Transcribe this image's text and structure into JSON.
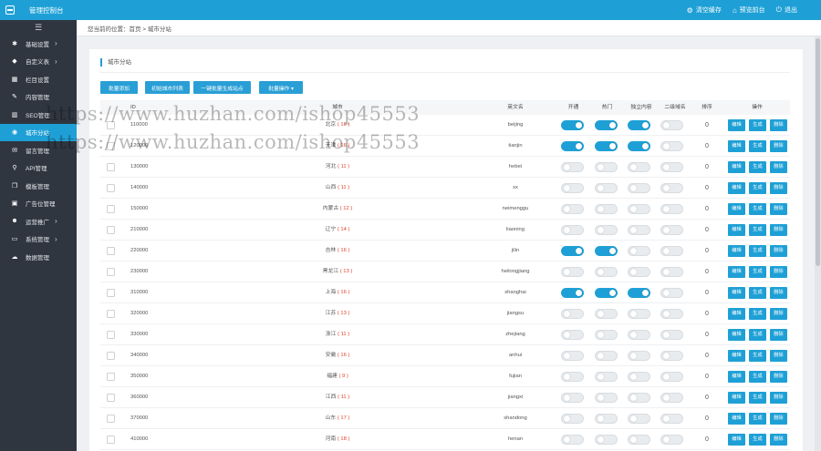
{
  "app": {
    "title": "管理控制台"
  },
  "topbar": {
    "actions": [
      {
        "icon": "gear-icon",
        "glyph": "⚙",
        "label": "清空缓存"
      },
      {
        "icon": "home-icon",
        "glyph": "⌂",
        "label": "预览前台"
      },
      {
        "icon": "power-icon",
        "glyph": "⏻",
        "label": "退出"
      }
    ]
  },
  "sidebar": {
    "toggle_glyph": "☰",
    "items": [
      {
        "icon": "gear-icon",
        "glyph": "✱",
        "label": "基础设置",
        "arrow": "›"
      },
      {
        "icon": "tag-icon",
        "glyph": "◆",
        "label": "自定义表",
        "arrow": "›"
      },
      {
        "icon": "grid-icon",
        "glyph": "▦",
        "label": "栏目设置",
        "arrow": ""
      },
      {
        "icon": "edit-icon",
        "glyph": "✎",
        "label": "内容管理",
        "arrow": ""
      },
      {
        "icon": "chart-icon",
        "glyph": "▥",
        "label": "SEO管理",
        "arrow": ""
      },
      {
        "icon": "globe-icon",
        "glyph": "◉",
        "label": "城市分站",
        "arrow": ""
      },
      {
        "icon": "chat-icon",
        "glyph": "✉",
        "label": "留言管理",
        "arrow": ""
      },
      {
        "icon": "link-icon",
        "glyph": "⚲",
        "label": "API管理",
        "arrow": ""
      },
      {
        "icon": "copy-icon",
        "glyph": "❐",
        "label": "模板管理",
        "arrow": ""
      },
      {
        "icon": "image-icon",
        "glyph": "▣",
        "label": "广告位管理",
        "arrow": ""
      },
      {
        "icon": "users-icon",
        "glyph": "☻",
        "label": "运营推广",
        "arrow": "›"
      },
      {
        "icon": "monitor-icon",
        "glyph": "▭",
        "label": "系统管理",
        "arrow": "›"
      },
      {
        "icon": "cloud-icon",
        "glyph": "☁",
        "label": "数据管理",
        "arrow": ""
      }
    ]
  },
  "breadcrumb": "您当前的位置：首页 > 城市分站",
  "panel": {
    "title": "城市分站"
  },
  "toolbar": {
    "buttons": [
      "批量添加",
      "初始城市列表",
      "一键批量生成站点",
      "批量操作 ▾"
    ]
  },
  "table": {
    "headers": {
      "id": "ID",
      "name": "城市",
      "pinyin": "英文名",
      "open": "开通",
      "hot": "热门",
      "independent": "独立内容",
      "second_domain": "二级域名",
      "order": "排序",
      "ops": "操作"
    },
    "op_labels": [
      "编辑",
      "生成",
      "删除"
    ],
    "rows": [
      {
        "code": "110000",
        "name": "北京",
        "count": "( 16 )",
        "pinyin": "beijing",
        "open": true,
        "hot": true,
        "independent": true,
        "second": false,
        "order": "0"
      },
      {
        "code": "120000",
        "name": "天津",
        "count": "( 16 )",
        "pinyin": "tianjin",
        "open": true,
        "hot": true,
        "independent": true,
        "second": false,
        "order": "0"
      },
      {
        "code": "130000",
        "name": "河北",
        "count": "( 11 )",
        "pinyin": "hebei",
        "open": false,
        "hot": false,
        "independent": false,
        "second": false,
        "order": "0"
      },
      {
        "code": "140000",
        "name": "山西",
        "count": "( 11 )",
        "pinyin": "sx",
        "open": false,
        "hot": false,
        "independent": false,
        "second": false,
        "order": "0"
      },
      {
        "code": "150000",
        "name": "内蒙古",
        "count": "( 12 )",
        "pinyin": "neimenggu",
        "open": false,
        "hot": false,
        "independent": false,
        "second": false,
        "order": "0"
      },
      {
        "code": "210000",
        "name": "辽宁",
        "count": "( 14 )",
        "pinyin": "liaoning",
        "open": false,
        "hot": false,
        "independent": false,
        "second": false,
        "order": "0"
      },
      {
        "code": "220000",
        "name": "吉林",
        "count": "( 16 )",
        "pinyin": "jilin",
        "open": true,
        "hot": true,
        "independent": false,
        "second": false,
        "order": "0"
      },
      {
        "code": "230000",
        "name": "黑龙江",
        "count": "( 13 )",
        "pinyin": "heilongjiang",
        "open": false,
        "hot": false,
        "independent": false,
        "second": false,
        "order": "0"
      },
      {
        "code": "310000",
        "name": "上海",
        "count": "( 16 )",
        "pinyin": "shanghai",
        "open": true,
        "hot": true,
        "independent": true,
        "second": false,
        "order": "0"
      },
      {
        "code": "320000",
        "name": "江苏",
        "count": "( 13 )",
        "pinyin": "jiangsu",
        "open": false,
        "hot": false,
        "independent": false,
        "second": false,
        "order": "0"
      },
      {
        "code": "330000",
        "name": "浙江",
        "count": "( 11 )",
        "pinyin": "zhejiang",
        "open": false,
        "hot": false,
        "independent": false,
        "second": false,
        "order": "0"
      },
      {
        "code": "340000",
        "name": "安徽",
        "count": "( 16 )",
        "pinyin": "anhui",
        "open": false,
        "hot": false,
        "independent": false,
        "second": false,
        "order": "0"
      },
      {
        "code": "350000",
        "name": "福建",
        "count": "( 9 )",
        "pinyin": "fujian",
        "open": false,
        "hot": false,
        "independent": false,
        "second": false,
        "order": "0"
      },
      {
        "code": "360000",
        "name": "江西",
        "count": "( 11 )",
        "pinyin": "jiangxi",
        "open": false,
        "hot": false,
        "independent": false,
        "second": false,
        "order": "0"
      },
      {
        "code": "370000",
        "name": "山东",
        "count": "( 17 )",
        "pinyin": "shandong",
        "open": false,
        "hot": false,
        "independent": false,
        "second": false,
        "order": "0"
      },
      {
        "code": "410000",
        "name": "河南",
        "count": "( 18 )",
        "pinyin": "henan",
        "open": false,
        "hot": false,
        "independent": false,
        "second": false,
        "order": "0"
      }
    ]
  },
  "watermark": [
    "https://www.huzhan.com/ishop45553",
    "https://www.huzhan.com/ishop45553"
  ],
  "colors": {
    "accent": "#1ea0d6",
    "sidebar": "#2f3640",
    "count_red": "#e0412c"
  }
}
